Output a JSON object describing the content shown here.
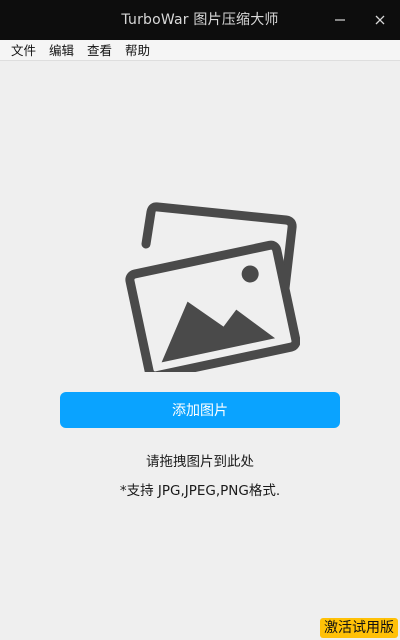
{
  "window": {
    "title": "TurboWar 图片压缩大师"
  },
  "menu": {
    "items": [
      "文件",
      "编辑",
      "查看",
      "帮助"
    ]
  },
  "main": {
    "illustration_icon": "image-stack-icon",
    "add_button_label": "添加图片",
    "drag_hint": "请拖拽图片到此处",
    "formats_hint": "*支持 JPG,JPEG,PNG格式."
  },
  "footer": {
    "activate_label": "激活试用版"
  },
  "colors": {
    "titlebar": "#0d0d0d",
    "background": "#efefef",
    "accent": "#0aa3ff",
    "illustration": "#4a4a4a",
    "activate_badge": "#ffc107"
  }
}
